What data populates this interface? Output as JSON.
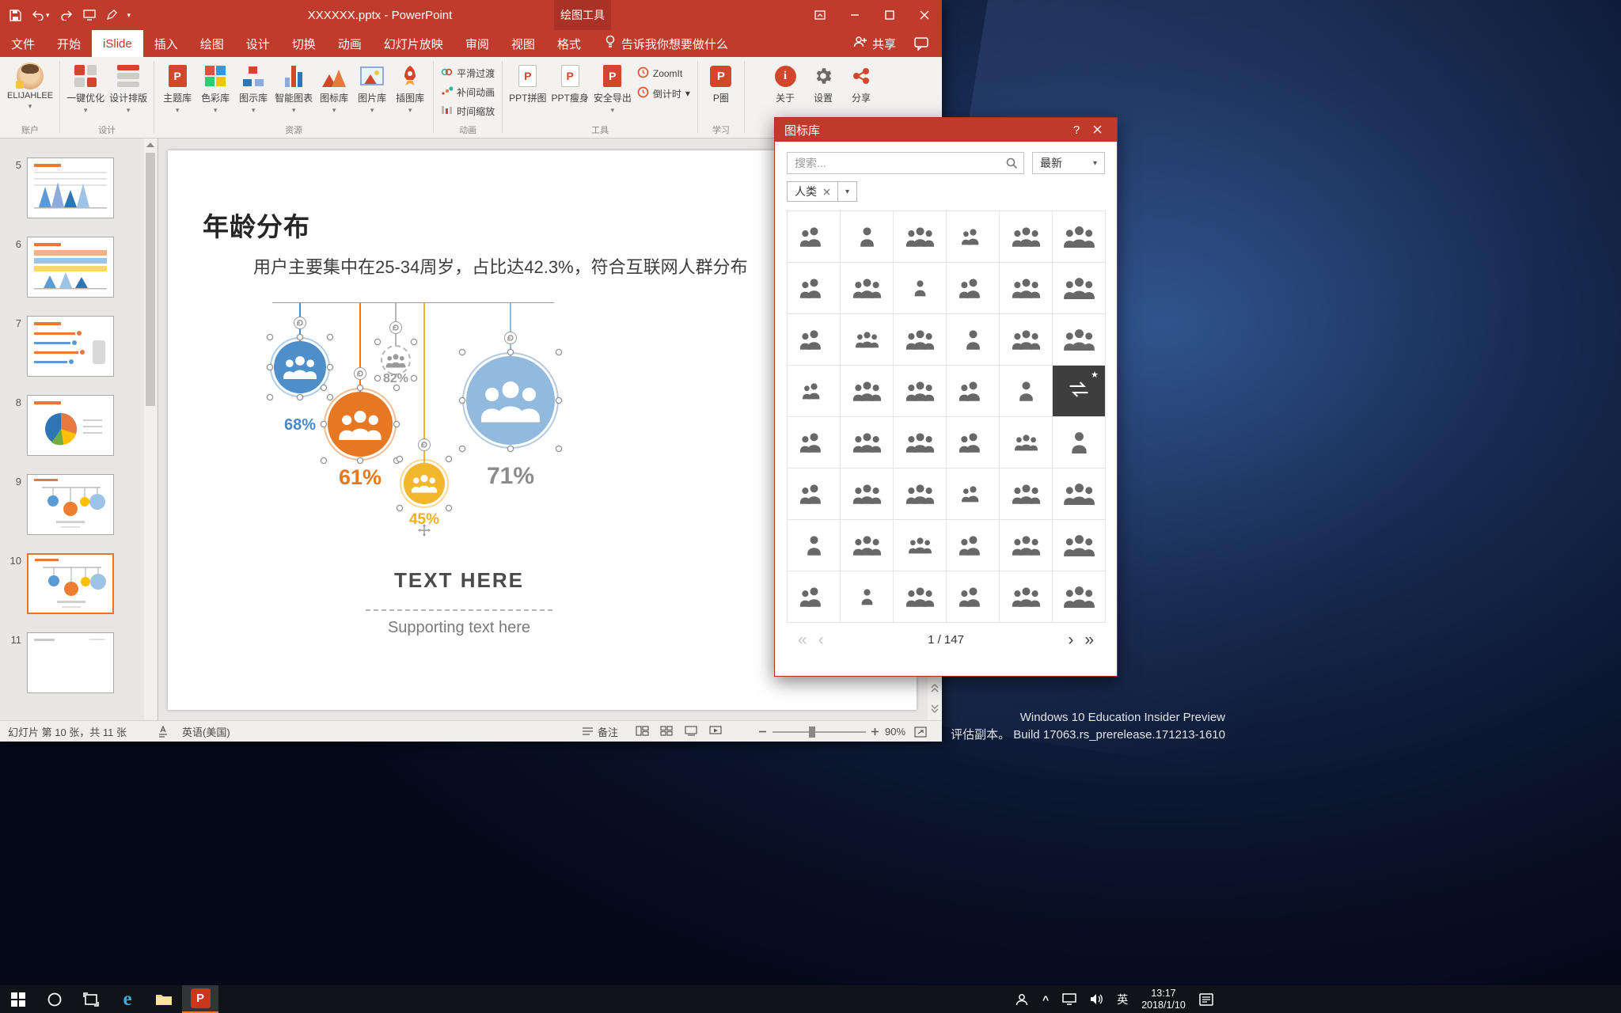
{
  "glyphs": {
    "dropdown": "▾",
    "p": "P",
    "i": "i",
    "help": "?",
    "first": "«",
    "prev": "‹",
    "next": "›",
    "last": "»",
    "star": "★",
    "caret": "^",
    "edge": "e"
  },
  "titlebar": {
    "title": "XXXXXX.pptx  -  PowerPoint",
    "context_header": "绘图工具"
  },
  "tabs": [
    "文件",
    "开始",
    "iSlide",
    "插入",
    "绘图",
    "设计",
    "切换",
    "动画",
    "幻灯片放映",
    "审阅",
    "视图",
    "格式"
  ],
  "ribbon": {
    "tell_me": "告诉我你想要做什么",
    "share": "共享",
    "account": {
      "label": "账户",
      "user": "ELIJAHLEE"
    },
    "design": {
      "label": "设计",
      "items": [
        "一键优化",
        "设计排版"
      ]
    },
    "resources": {
      "label": "资源",
      "items": [
        "主题库",
        "色彩库",
        "图示库",
        "智能图表",
        "图标库",
        "图片库",
        "插图库"
      ]
    },
    "animation": {
      "label": "动画",
      "items": [
        "平滑过渡",
        "补间动画",
        "时间缩放"
      ]
    },
    "tools": {
      "label": "工具",
      "items": [
        "PPT拼图",
        "PPT瘦身",
        "安全导出"
      ],
      "side": [
        "ZoomIt",
        "倒计时"
      ]
    },
    "learning": {
      "label": "学习",
      "items": [
        "P圈"
      ]
    },
    "misc": {
      "items": [
        "关于",
        "设置",
        "分享"
      ]
    }
  },
  "slide_panel": {
    "slides": [
      {
        "num": "5"
      },
      {
        "num": "6"
      },
      {
        "num": "7"
      },
      {
        "num": "8"
      },
      {
        "num": "9"
      },
      {
        "num": "10"
      },
      {
        "num": "11"
      }
    ],
    "selected": "10"
  },
  "slide": {
    "title": "年龄分布",
    "subtitle": "用户主要集中在25-34周岁，占比达42.3%，符合互联网人群分布",
    "ornaments": [
      {
        "pct": "68%",
        "fill": "#4E8FCB",
        "label_color": "#4A89C8"
      },
      {
        "pct": "82%",
        "fill": "#FFFFFF",
        "label_color": "#9B9B9B"
      },
      {
        "pct": "61%",
        "fill": "#E87722",
        "label_color": "#E87722"
      },
      {
        "pct": "45%",
        "fill": "#F2B72E",
        "label_color": "#EFAF1F"
      },
      {
        "pct": "71%",
        "fill": "#92B9DE",
        "label_color": "#8C8C8C"
      }
    ],
    "text_here": "TEXT HERE",
    "supporting": "Supporting text here"
  },
  "status_bar": {
    "slide_info": "幻灯片 第 10 张，共 11 张",
    "language": "英语(美国)",
    "notes": "备注",
    "zoom": "90%"
  },
  "icon_panel": {
    "title": "图标库",
    "search_placeholder": "搜索...",
    "sort": "最新",
    "filter": "人类",
    "page": "1 / 147",
    "icons": [
      "girl-face",
      "handshake",
      "people-with-chart",
      "user-check",
      "user-group",
      "person-speech-bubble",
      "elder-woman-glasses",
      "boy-glasses",
      "business-meeting",
      "businesswoman",
      "person-with-luggage",
      "woman-profile",
      "man-with-cap",
      "two-men",
      "woman-long-hair",
      "people-hierarchy",
      "woman-worker",
      "women-group",
      "contact-card",
      "person-x2",
      "woman-headscarf",
      "masked-performer",
      "dancer",
      "swap-people",
      "presenter-pointing",
      "construction-worker",
      "nurse",
      "hairdresser",
      "baby-face",
      "person-falling",
      "remove-user",
      "person-mowing",
      "people-row",
      "family-photo",
      "people-crowd",
      "person-walking",
      "person-running",
      "person-standing",
      "person-jumping",
      "mother-with-baby",
      "businessman-tie",
      "elder-portrait",
      "person-on-escalator",
      "swimmer",
      "person-with-heart",
      "bride",
      "doctor",
      "dog-walker"
    ]
  },
  "desktop": {
    "eval_line1": "Windows 10 Education Insider Preview",
    "eval_line2": "评估副本。 Build 17063.rs_prerelease.171213-1610"
  },
  "taskbar": {
    "time": "13:17",
    "date": "2018/1/10",
    "input_lang": "英"
  }
}
